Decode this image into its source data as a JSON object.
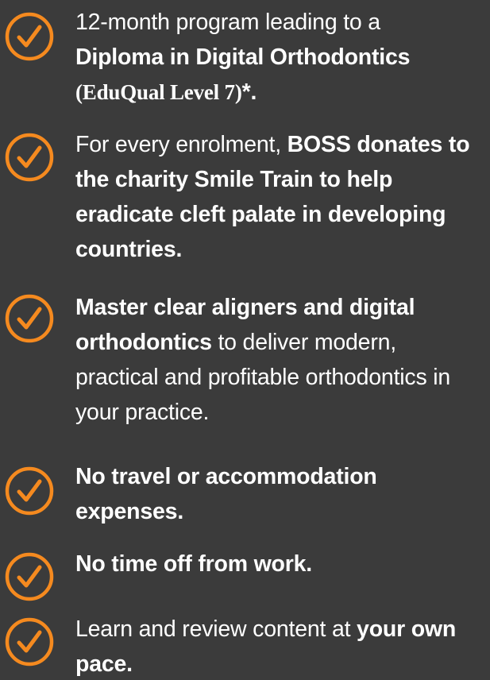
{
  "colors": {
    "background": "#3b3b3b",
    "accent": "#f58a1f",
    "text": "#ffffff"
  },
  "icon": "check-circle-icon",
  "items": [
    {
      "prefix": "12-month program leading to a ",
      "bold": "Diploma in Digital Orthodontics",
      "serif_bold": "(EduQual Level 7)",
      "suffix_bold": "*."
    },
    {
      "prefix": "For every enrolment, ",
      "bold": "BOSS donates to the charity Smile Train to help eradicate cleft palate in developing countries."
    },
    {
      "bold": "Master clear aligners and digital orthodontics",
      "suffix": " to deliver modern, practical and profitable orthodontics in your practice."
    },
    {
      "bold": "No travel or accommodation expenses."
    },
    {
      "bold": "No time off from work."
    },
    {
      "prefix": "Learn and review content at ",
      "bold": "your own pace."
    }
  ]
}
